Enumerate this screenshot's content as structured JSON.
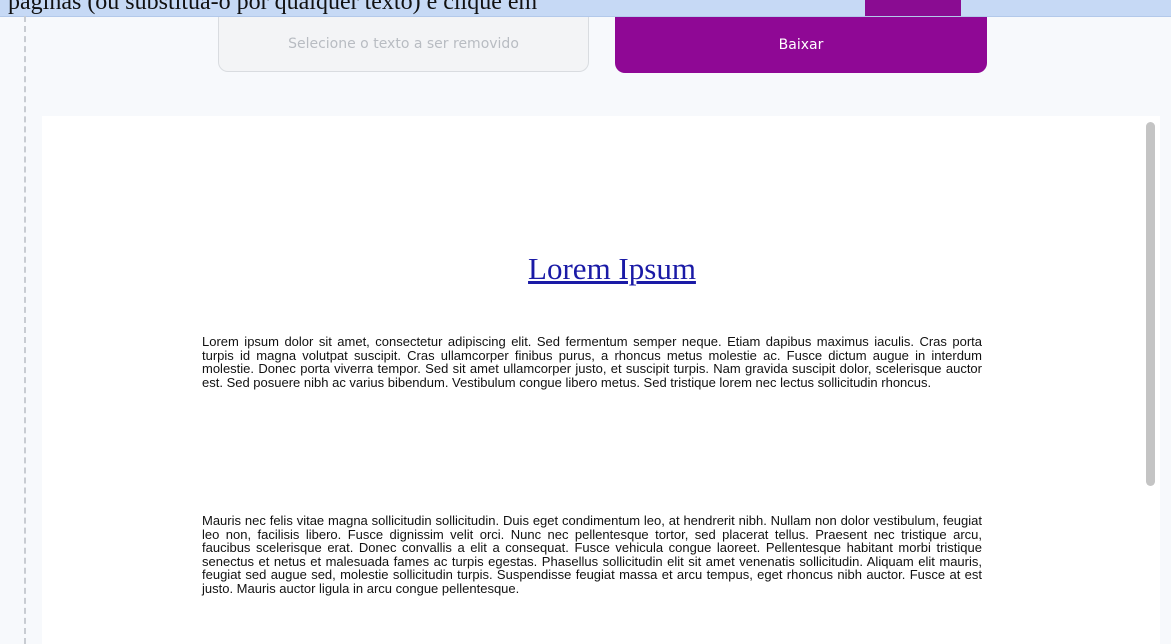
{
  "banner": {
    "text": "páginas (ou substitua-o por qualquer texto) e clique em",
    "highlight_color": "#8a0c92"
  },
  "toolbar": {
    "select_text_placeholder": "Selecione o texto a ser removido",
    "download_label": "Baixar",
    "accent_color": "#8f0895"
  },
  "document": {
    "title": "Lorem Ipsum",
    "paragraphs": [
      "Lorem ipsum dolor sit amet, consectetur adipiscing elit. Sed fermentum semper neque. Etiam dapibus maximus iaculis. Cras porta turpis id magna volutpat suscipit. Cras ullamcorper finibus purus, a rhoncus metus molestie ac. Fusce dictum augue in interdum molestie. Donec porta viverra tempor. Sed sit amet ullamcorper justo, et suscipit turpis. Nam gravida suscipit dolor, scelerisque auctor est. Sed posuere nibh ac varius bibendum. Vestibulum congue libero metus. Sed tristique lorem nec lectus sollicitudin rhoncus.",
      "Mauris nec felis vitae magna sollicitudin sollicitudin. Duis eget condimentum leo, at hendrerit nibh. Nullam non dolor vestibulum, feugiat leo non, facilisis libero. Fusce dignissim velit orci. Nunc nec pellentesque tortor, sed placerat tellus. Praesent nec tristique arcu, faucibus scelerisque erat. Donec convallis a elit a consequat. Fusce vehicula congue laoreet. Pellentesque habitant morbi tristique senectus et netus et malesuada fames ac turpis egestas. Phasellus sollicitudin elit sit amet venenatis sollicitudin. Aliquam elit mauris, feugiat sed augue sed, molestie sollicitudin turpis. Suspendisse feugiat massa et arcu tempus, eget rhoncus nibh auctor. Fusce at est justo. Mauris auctor ligula in arcu congue pellentesque."
    ]
  }
}
